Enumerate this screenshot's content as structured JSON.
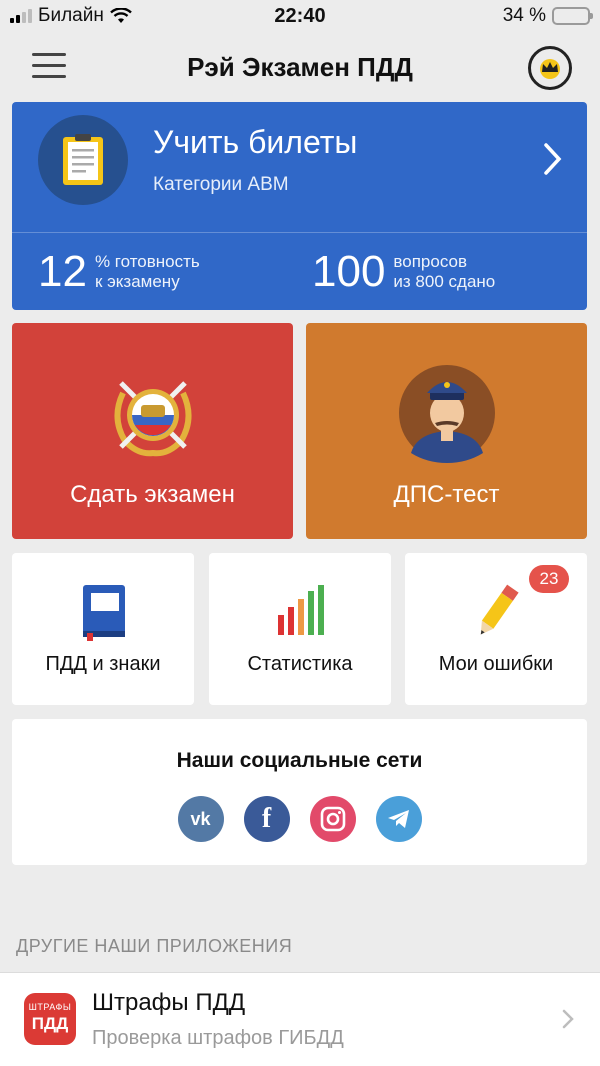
{
  "status_bar": {
    "carrier": "Билайн",
    "time": "22:40",
    "battery": "34 %",
    "battery_level": 0.34
  },
  "nav": {
    "title": "Рэй Экзамен ПДД",
    "menu_icon": "hamburger-icon",
    "premium_icon": "crown-icon"
  },
  "learn_card": {
    "title": "Учить билеты",
    "subtitle": "Категории ABM",
    "readiness_value": "12",
    "readiness_label_1": "% готовность",
    "readiness_label_2": "к экзамену",
    "questions_value": "100",
    "questions_label_1": "вопросов",
    "questions_label_2": "из 800 сдано",
    "color": "#3068C8"
  },
  "tiles": {
    "exam": {
      "label": "Сдать экзамен",
      "color": "#D2423A"
    },
    "dps": {
      "label": "ДПС-тест",
      "color": "#D07A2E"
    }
  },
  "small_tiles": {
    "rules": {
      "label": "ПДД и знаки"
    },
    "stats": {
      "label": "Статистика"
    },
    "mistakes": {
      "label": "Мои ошибки",
      "badge": "23"
    }
  },
  "social": {
    "title": "Наши социальные сети",
    "networks": [
      "vk",
      "facebook",
      "instagram",
      "telegram"
    ],
    "vk_label": "vk",
    "fb_label": "f"
  },
  "other_apps": {
    "header": "ДРУГИЕ НАШИ ПРИЛОЖЕНИЯ",
    "items": [
      {
        "icon_top": "ШТРАФЫ",
        "icon_bottom": "ПДД",
        "title": "Штрафы ПДД",
        "subtitle": "Проверка штрафов ГИБДД"
      }
    ]
  }
}
